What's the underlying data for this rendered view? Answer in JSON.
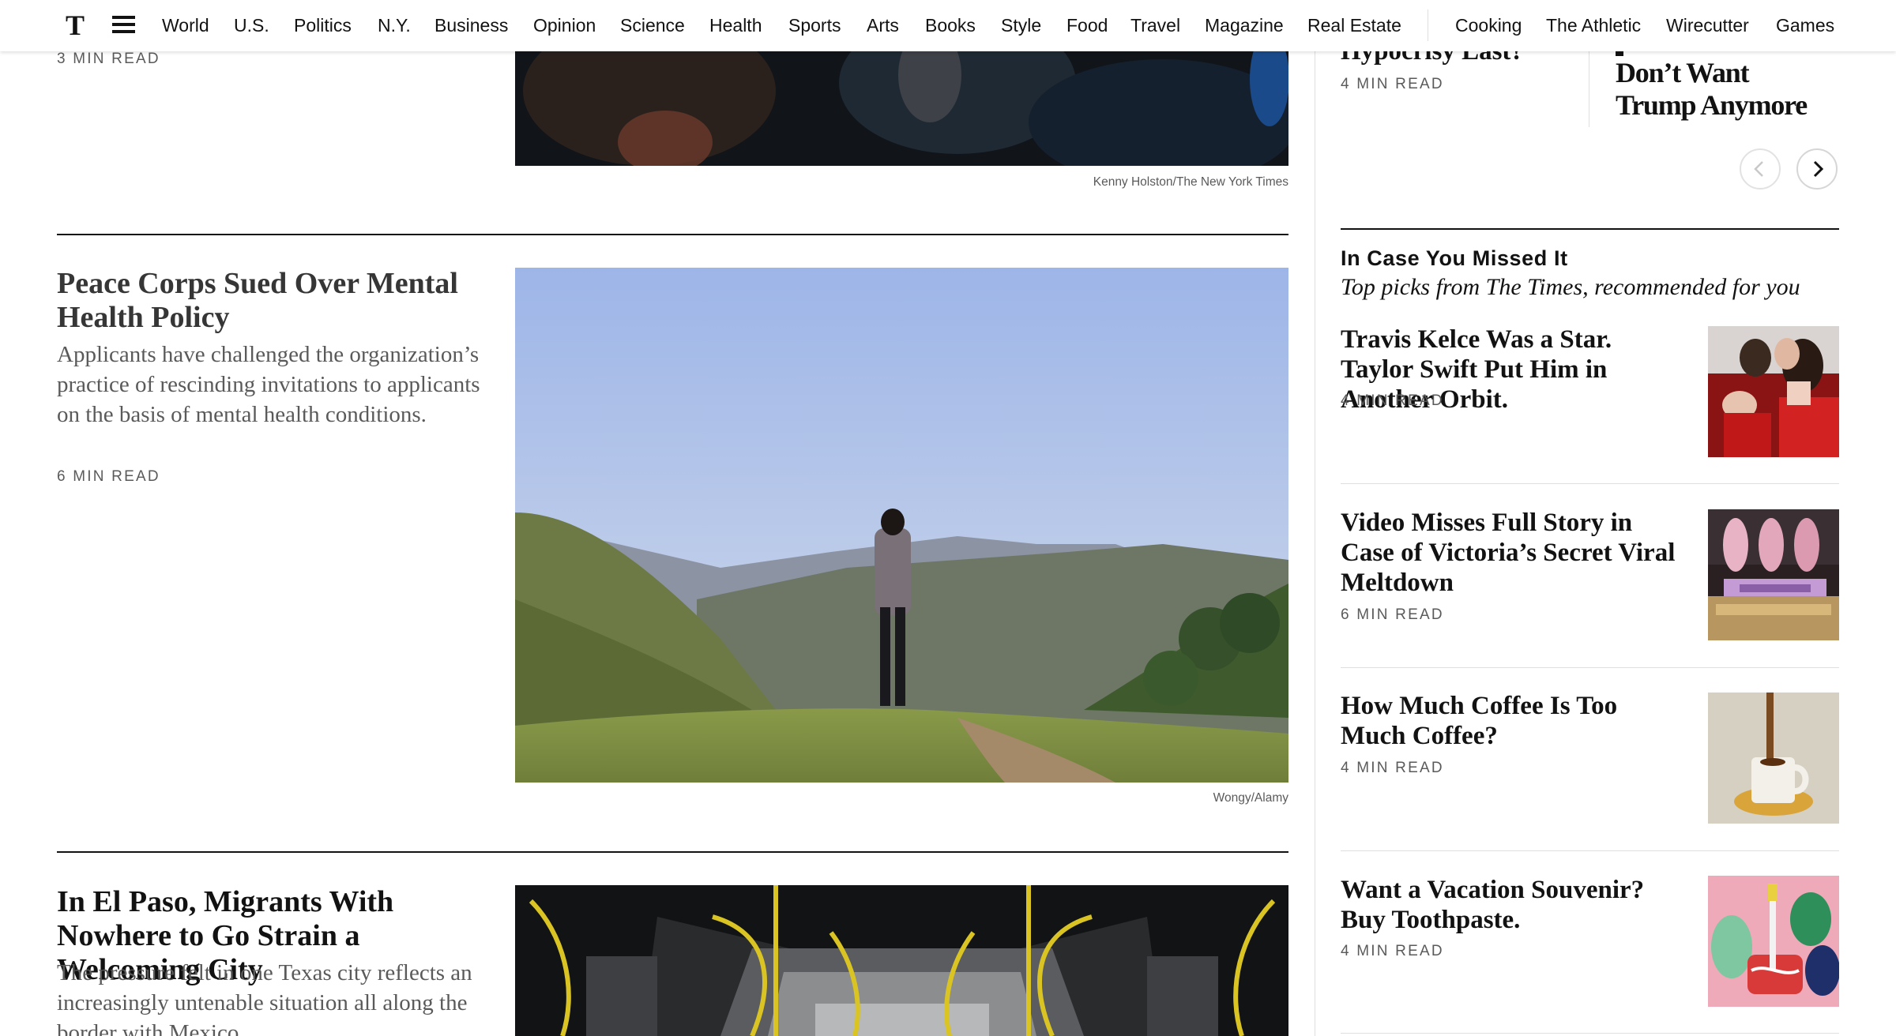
{
  "nav": {
    "logo": "T",
    "items": [
      "World",
      "U.S.",
      "Politics",
      "N.Y.",
      "Business",
      "Opinion",
      "Science",
      "Health",
      "Sports",
      "Arts",
      "Books",
      "Style",
      "Food",
      "Travel",
      "Magazine",
      "Real Estate"
    ],
    "products": [
      "Cooking",
      "The Athletic",
      "Wirecutter",
      "Games"
    ]
  },
  "main": {
    "top_read_time": "3 MIN READ",
    "top_photo_credit": "Kenny Holston/The New York Times",
    "stories": [
      {
        "headline": "Peace Corps Sued Over Mental Health Policy",
        "summary": "Applicants have challenged the organization’s practice of rescinding invitations to applicants on the basis of mental health conditions.",
        "read_time": "6 MIN READ",
        "photo_credit": "Wongy/Alamy"
      },
      {
        "headline": "In El Paso, Migrants With Nowhere to Go Strain a Welcoming City",
        "summary": "The pressure felt in one Texas city reflects an increasingly untenable situation all along the border with Mexico."
      }
    ]
  },
  "rail": {
    "carousel": [
      {
        "headline": "Hypocrisy Last?",
        "read_time": "4 MIN READ"
      },
      {
        "headline": "Don’t Want Trump Anymore"
      }
    ],
    "section_title": "In Case You Missed It",
    "section_subtitle": "Top picks from The Times, recommended for you",
    "items": [
      {
        "headline": "Travis Kelce Was a Star. Taylor Swift Put Him in Another Orbit.",
        "read_time": "4 MIN READ"
      },
      {
        "headline": "Video Misses Full Story in Case of Victoria’s Secret Viral Meltdown",
        "read_time": "6 MIN READ"
      },
      {
        "headline": "How Much Coffee Is Too Much Coffee?",
        "read_time": "4 MIN READ"
      },
      {
        "headline": "Want a Vacation Souvenir? Buy Toothpaste.",
        "read_time": "4 MIN READ"
      }
    ]
  }
}
